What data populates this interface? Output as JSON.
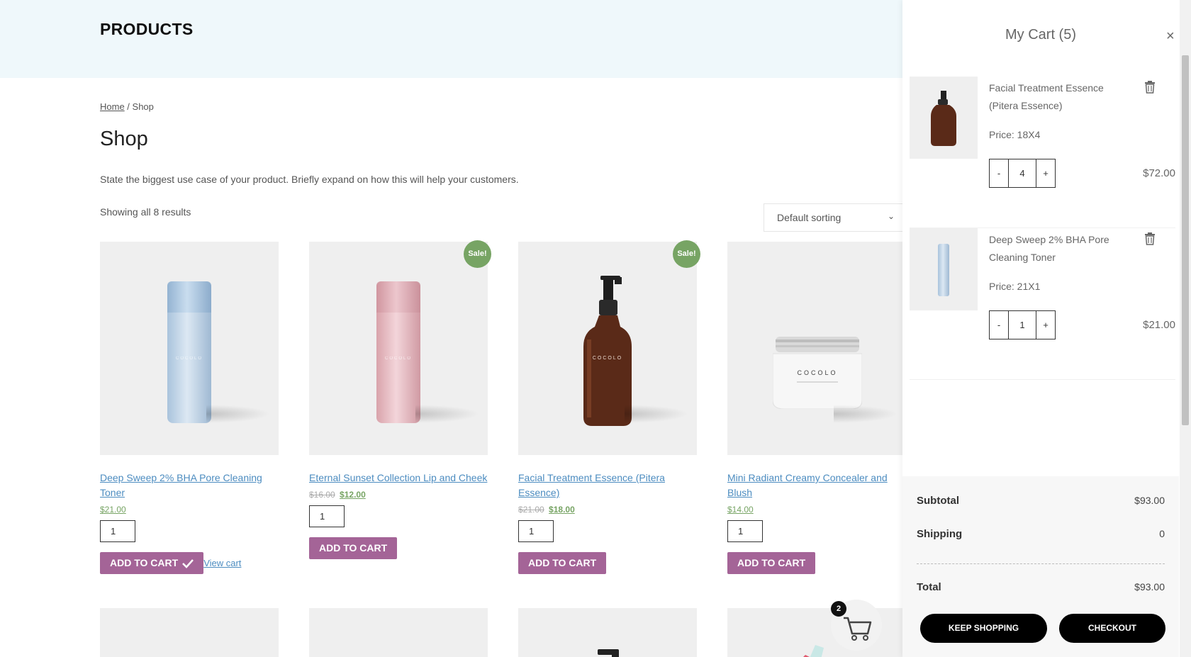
{
  "header": {
    "title": "PRODUCTS"
  },
  "breadcrumb": {
    "home": "Home",
    "separator": " / ",
    "current": "Shop"
  },
  "shop": {
    "title": "Shop",
    "description": "State the biggest use case of your product. Briefly expand on how this will help your customers.",
    "result_count": "Showing all 8 results",
    "sorting": "Default sorting"
  },
  "products": [
    {
      "name": "Deep Sweep 2% BHA Pore Cleaning Toner",
      "price": "$21.00",
      "old_price": "",
      "qty": "1",
      "button": "ADD TO CART",
      "view_cart": "View cart",
      "sale": ""
    },
    {
      "name": "Eternal Sunset Collection Lip and Cheek",
      "price": "$12.00",
      "old_price": "$16.00",
      "qty": "1",
      "button": "ADD TO CART",
      "view_cart": "",
      "sale": "Sale!"
    },
    {
      "name": "Facial Treatment Essence (Pitera Essence)",
      "price": "$18.00",
      "old_price": "$21.00",
      "qty": "1",
      "button": "ADD TO CART",
      "view_cart": "",
      "sale": "Sale!"
    },
    {
      "name": "Mini Radiant Creamy Concealer and Blush",
      "price": "$14.00",
      "old_price": "",
      "qty": "1",
      "button": "ADD TO CART",
      "view_cart": "",
      "sale": ""
    }
  ],
  "floating_cart": {
    "count": "2"
  },
  "cart": {
    "title": "My Cart (5)",
    "close": "×",
    "items": [
      {
        "name": "Facial Treatment Essence (Pitera Essence)",
        "price_label": "Price: 18X4",
        "qty": "4",
        "total": "$72.00",
        "minus": "-",
        "plus": "+"
      },
      {
        "name": "Deep Sweep 2% BHA Pore Cleaning Toner",
        "price_label": "Price: 21X1",
        "qty": "1",
        "total": "$21.00",
        "minus": "-",
        "plus": "+"
      }
    ],
    "subtotal_label": "Subtotal",
    "subtotal": "$93.00",
    "shipping_label": "Shipping",
    "shipping": "0",
    "total_label": "Total",
    "total": "$93.00",
    "keep_shopping": "KEEP SHOPPING",
    "checkout": "CHECKOUT"
  },
  "colors": {
    "header_bg": "#eff8fb",
    "accent_button": "#a46497",
    "sale_badge": "#77a464",
    "link": "#4c8cc0"
  }
}
